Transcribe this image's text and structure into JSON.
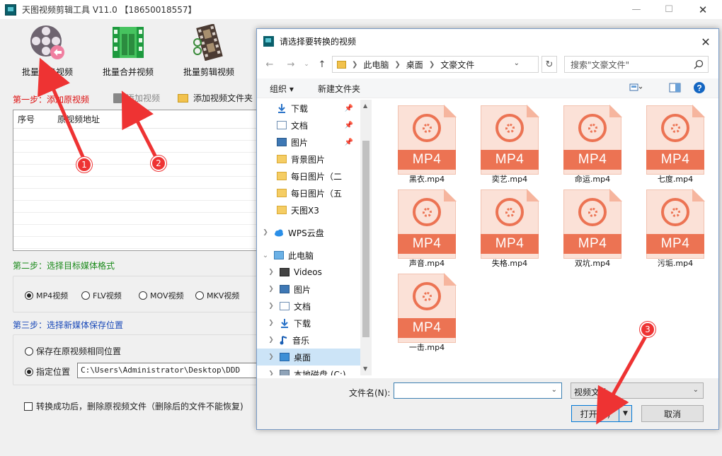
{
  "app": {
    "title": "天图视频剪辑工具 V11.0 【18650018557】",
    "tools": [
      {
        "label": "批量转换视频",
        "icon": "film-reel-icon"
      },
      {
        "label": "批量合并视频",
        "icon": "film-strip-icon"
      },
      {
        "label": "批量剪辑视频",
        "icon": "film-scissors-icon"
      }
    ],
    "step1": "第一步：添加原视频",
    "add_video": "添加视频",
    "add_folder": "添加视频文件夹",
    "table_headers": [
      "序号",
      "原视频地址"
    ],
    "step2": "第二步：选择目标媒体格式",
    "formats": [
      {
        "label": "MP4视频",
        "selected": true
      },
      {
        "label": "FLV视频",
        "selected": false
      },
      {
        "label": "MOV视频",
        "selected": false
      },
      {
        "label": "MKV视频",
        "selected": false
      }
    ],
    "step3": "第三步：选择新媒体保存位置",
    "save_same": "保存在原视频相同位置",
    "save_custom": "指定位置",
    "save_path": "C:\\Users\\Administrator\\Desktop\\DDD",
    "delete_after": "转换成功后，删除原视频文件（删除后的文件不能恢复)"
  },
  "annotations": [
    "1",
    "2",
    "3"
  ],
  "colors": {
    "annotation": "#e33333",
    "mp4_accent": "#ec7353",
    "selection": "#cce4f7",
    "primary_border": "#0078d7"
  },
  "dialog": {
    "title": "请选择要转换的视频",
    "breadcrumb": [
      "此电脑",
      "桌面",
      "文豪文件"
    ],
    "search_placeholder": "搜索\"文豪文件\"",
    "organize": "组织 ▾",
    "new_folder": "新建文件夹",
    "nav_quick": [
      {
        "label": "下载",
        "icon": "download-icon",
        "pinned": true
      },
      {
        "label": "文档",
        "icon": "document-icon",
        "pinned": true
      },
      {
        "label": "图片",
        "icon": "picture-icon",
        "pinned": true
      },
      {
        "label": "背景图片",
        "icon": "folder-icon",
        "pinned": false
      },
      {
        "label": "每日图片（二",
        "icon": "folder-icon",
        "pinned": false
      },
      {
        "label": "每日图片（五",
        "icon": "folder-icon",
        "pinned": false
      },
      {
        "label": "天图X3",
        "icon": "folder-icon",
        "pinned": false
      }
    ],
    "nav_wps": "WPS云盘",
    "nav_pc": "此电脑",
    "nav_pc_items": [
      {
        "label": "Videos",
        "icon": "video-folder-icon"
      },
      {
        "label": "图片",
        "icon": "picture-icon"
      },
      {
        "label": "文档",
        "icon": "document-icon"
      },
      {
        "label": "下载",
        "icon": "download-icon"
      },
      {
        "label": "音乐",
        "icon": "music-icon"
      },
      {
        "label": "桌面",
        "icon": "desktop-icon"
      },
      {
        "label": "本地磁盘 (C:)",
        "icon": "disk-icon"
      }
    ],
    "files": [
      "黑衣.mp4",
      "奕艺.mp4",
      "命运.mp4",
      "七度.mp4",
      "声音.mp4",
      "失格.mp4",
      "双坑.mp4",
      "污垢.mp4",
      "一击.mp4"
    ],
    "file_badge": "MP4",
    "filename_label": "文件名(N):",
    "filename_value": "",
    "filter": "视频文件",
    "open": "打开(O)",
    "cancel": "取消"
  }
}
